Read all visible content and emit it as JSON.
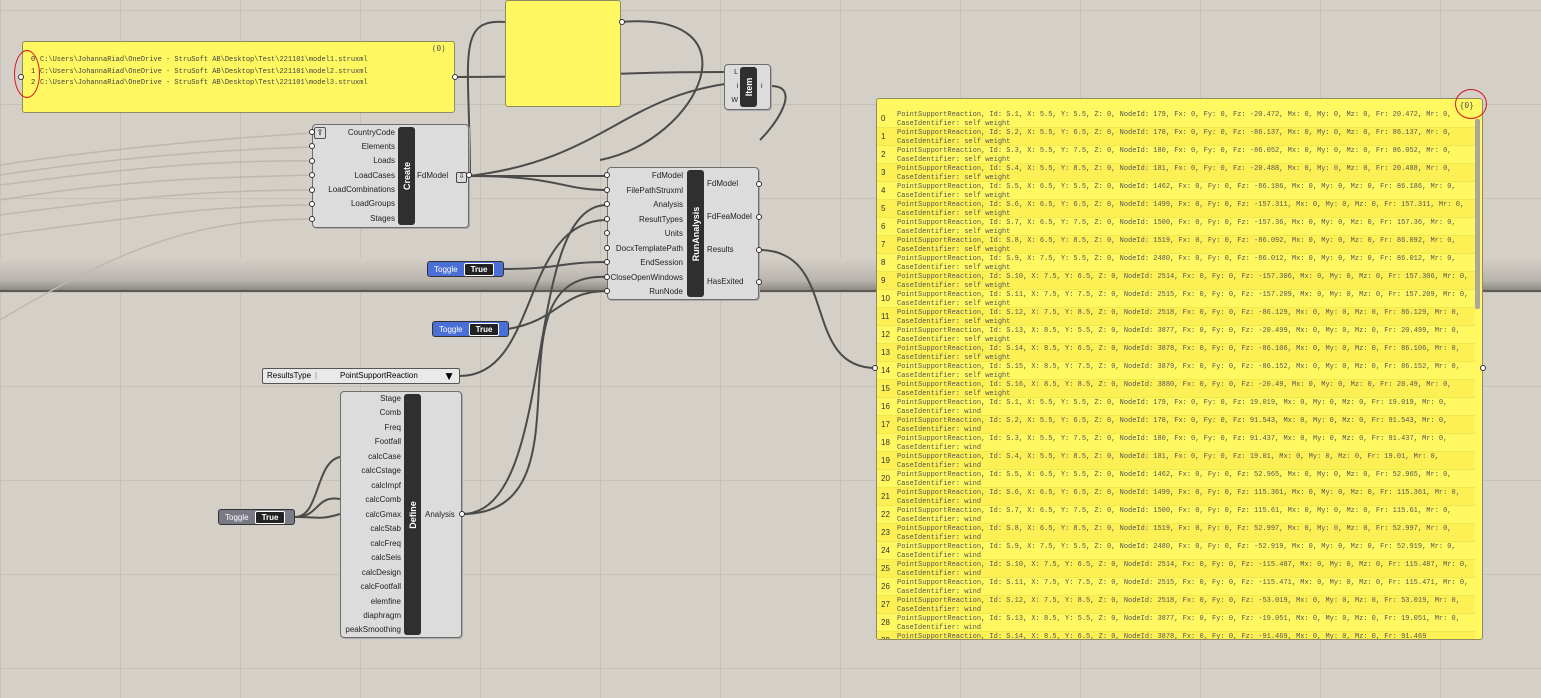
{
  "colors": {
    "canvas": "#d4d0c8",
    "panel_yellow": "#fff860",
    "toggle_blue": "#4a6fd6",
    "toggle_gray": "#7a7a86",
    "annotation_red": "#d8141c"
  },
  "path_panel": {
    "badge": "(0)",
    "items": [
      {
        "index": "0",
        "path": "C:\\Users\\JohannaRiad\\OneDrive - StruSoft AB\\Desktop\\Test\\221101\\model1.struxml"
      },
      {
        "index": "1",
        "path": "C:\\Users\\JohannaRiad\\OneDrive - StruSoft AB\\Desktop\\Test\\221101\\model2.struxml"
      },
      {
        "index": "2",
        "path": "C:\\Users\\JohannaRiad\\OneDrive - StruSoft AB\\Desktop\\Test\\221101\\model3.struxml"
      }
    ]
  },
  "item_component": {
    "inputs": [
      "L",
      "i",
      "W"
    ],
    "label": "Item",
    "output": "i"
  },
  "create_component": {
    "label": "Create",
    "inputs": [
      "CountryCode",
      "Elements",
      "Loads",
      "LoadCases",
      "LoadCombinations",
      "LoadGroups",
      "Stages"
    ],
    "output": "FdModel"
  },
  "run_component": {
    "label": "RunAnalysis",
    "inputs": [
      "FdModel",
      "FilePathStruxml",
      "Analysis",
      "ResultTypes",
      "Units",
      "DocxTemplatePath",
      "EndSession",
      "CloseOpenWindows",
      "RunNode"
    ],
    "outputs": [
      "FdModel",
      "FdFeaModel",
      "Results",
      "HasExited"
    ]
  },
  "toggles": [
    {
      "label": "Toggle",
      "value": "True"
    },
    {
      "label": "Toggle",
      "value": "True"
    },
    {
      "label": "Toggle",
      "value": "True"
    }
  ],
  "value_list": {
    "name": "ResultsType",
    "selected": "PointSupportReaction"
  },
  "define_component": {
    "label": "Define",
    "inputs": [
      "Stage",
      "Comb",
      "Freq",
      "Footfall",
      "calcCase",
      "calcCstage",
      "calcImpf",
      "calcComb",
      "calcGmax",
      "calcStab",
      "calcFreq",
      "calcSeis",
      "calcDesign",
      "calcFootfall",
      "elemfine",
      "diaphragm",
      "peakSmoothing"
    ],
    "output": "Analysis"
  },
  "results_panel": {
    "badge": "{0}",
    "rows": [
      {
        "index": "0",
        "text": "PointSupportReaction, Id: S.1, X: 5.5, Y: 5.5, Z: 0, NodeId: 179, Fx: 0, Fy: 0, Fz: -20.472, Mx: 0, My: 0, Mz: 0, Fr: 20.472, Mr: 0, CaseIdentifier: self weight"
      },
      {
        "index": "1",
        "text": "PointSupportReaction, Id: S.2, X: 5.5, Y: 6.5, Z: 0, NodeId: 178, Fx: 0, Fy: 0, Fz: -86.137, Mx: 0, My: 0, Mz: 0, Fr: 86.137, Mr: 0, CaseIdentifier: self weight"
      },
      {
        "index": "2",
        "text": "PointSupportReaction, Id: S.3, X: 5.5, Y: 7.5, Z: 0, NodeId: 180, Fx: 0, Fy: 0, Fz: -86.052, Mx: 0, My: 0, Mz: 0, Fr: 86.052, Mr: 0, CaseIdentifier: self weight"
      },
      {
        "index": "3",
        "text": "PointSupportReaction, Id: S.4, X: 5.5, Y: 8.5, Z: 0, NodeId: 181, Fx: 0, Fy: 0, Fz: -20.488, Mx: 0, My: 0, Mz: 0, Fr: 20.488, Mr: 0, CaseIdentifier: self weight"
      },
      {
        "index": "4",
        "text": "PointSupportReaction, Id: S.5, X: 6.5, Y: 5.5, Z: 0, NodeId: 1462, Fx: 0, Fy: 0, Fz: -86.186, Mx: 0, My: 0, Mz: 0, Fr: 86.186, Mr: 0, CaseIdentifier: self weight"
      },
      {
        "index": "5",
        "text": "PointSupportReaction, Id: S.6, X: 6.5, Y: 6.5, Z: 0, NodeId: 1499, Fx: 0, Fy: 0, Fz: -157.311, Mx: 0, My: 0, Mz: 0, Fr: 157.311, Mr: 0, CaseIdentifier: self weight"
      },
      {
        "index": "6",
        "text": "PointSupportReaction, Id: S.7, X: 6.5, Y: 7.5, Z: 0, NodeId: 1500, Fx: 0, Fy: 0, Fz: -157.36, Mx: 0, My: 0, Mz: 0, Fr: 157.36, Mr: 0, CaseIdentifier: self weight"
      },
      {
        "index": "7",
        "text": "PointSupportReaction, Id: S.8, X: 6.5, Y: 8.5, Z: 0, NodeId: 1519, Fx: 0, Fy: 0, Fz: -86.092, Mx: 0, My: 0, Mz: 0, Fr: 86.092, Mr: 0, CaseIdentifier: self weight"
      },
      {
        "index": "8",
        "text": "PointSupportReaction, Id: S.9, X: 7.5, Y: 5.5, Z: 0, NodeId: 2480, Fx: 0, Fy: 0, Fz: -86.012, Mx: 0, My: 0, Mz: 0, Fr: 86.012, Mr: 0, CaseIdentifier: self weight"
      },
      {
        "index": "9",
        "text": "PointSupportReaction, Id: S.10, X: 7.5, Y: 6.5, Z: 0, NodeId: 2514, Fx: 0, Fy: 0, Fz: -157.306, Mx: 0, My: 0, Mz: 0, Fr: 157.306, Mr: 0, CaseIdentifier: self weight"
      },
      {
        "index": "10",
        "text": "PointSupportReaction, Id: S.11, X: 7.5, Y: 7.5, Z: 0, NodeId: 2515, Fx: 0, Fy: 0, Fz: -157.209, Mx: 0, My: 0, Mz: 0, Fr: 157.209, Mr: 0, CaseIdentifier: self weight"
      },
      {
        "index": "11",
        "text": "PointSupportReaction, Id: S.12, X: 7.5, Y: 8.5, Z: 0, NodeId: 2518, Fx: 0, Fy: 0, Fz: -86.129, Mx: 0, My: 0, Mz: 0, Fr: 86.129, Mr: 0, CaseIdentifier: self weight"
      },
      {
        "index": "12",
        "text": "PointSupportReaction, Id: S.13, X: 8.5, Y: 5.5, Z: 0, NodeId: 3877, Fx: 0, Fy: 0, Fz: -20.499, Mx: 0, My: 0, Mz: 0, Fr: 20.499, Mr: 0, CaseIdentifier: self weight"
      },
      {
        "index": "13",
        "text": "PointSupportReaction, Id: S.14, X: 8.5, Y: 6.5, Z: 0, NodeId: 3878, Fx: 0, Fy: 0, Fz: -86.106, Mx: 0, My: 0, Mz: 0, Fr: 86.106, Mr: 0, CaseIdentifier: self weight"
      },
      {
        "index": "14",
        "text": "PointSupportReaction, Id: S.15, X: 8.5, Y: 7.5, Z: 0, NodeId: 3879, Fx: 0, Fy: 0, Fz: -86.152, Mx: 0, My: 0, Mz: 0, Fr: 86.152, Mr: 0, CaseIdentifier: self weight"
      },
      {
        "index": "15",
        "text": "PointSupportReaction, Id: S.16, X: 8.5, Y: 8.5, Z: 0, NodeId: 3880, Fx: 0, Fy: 0, Fz: -20.49, Mx: 0, My: 0, Mz: 0, Fr: 20.49, Mr: 0, CaseIdentifier: self weight"
      },
      {
        "index": "16",
        "text": "PointSupportReaction, Id: S.1, X: 5.5, Y: 5.5, Z: 0, NodeId: 179, Fx: 0, Fy: 0, Fz: 19.019, Mx: 0, My: 0, Mz: 0, Fr: 19.019, Mr: 0, CaseIdentifier: wind"
      },
      {
        "index": "17",
        "text": "PointSupportReaction, Id: S.2, X: 5.5, Y: 6.5, Z: 0, NodeId: 178, Fx: 0, Fy: 0, Fz: 91.543, Mx: 0, My: 0, Mz: 0, Fr: 91.543, Mr: 0, CaseIdentifier: wind"
      },
      {
        "index": "18",
        "text": "PointSupportReaction, Id: S.3, X: 5.5, Y: 7.5, Z: 0, NodeId: 180, Fx: 0, Fy: 0, Fz: 91.437, Mx: 0, My: 0, Mz: 0, Fr: 91.437, Mr: 0, CaseIdentifier: wind"
      },
      {
        "index": "19",
        "text": "PointSupportReaction, Id: S.4, X: 5.5, Y: 8.5, Z: 0, NodeId: 181, Fx: 0, Fy: 0, Fz: 19.01, Mx: 0, My: 0, Mz: 0, Fr: 19.01, Mr: 0, CaseIdentifier: wind"
      },
      {
        "index": "20",
        "text": "PointSupportReaction, Id: S.5, X: 6.5, Y: 5.5, Z: 0, NodeId: 1462, Fx: 0, Fy: 0, Fz: 52.965, Mx: 0, My: 0, Mz: 0, Fr: 52.965, Mr: 0, CaseIdentifier: wind"
      },
      {
        "index": "21",
        "text": "PointSupportReaction, Id: S.6, X: 6.5, Y: 6.5, Z: 0, NodeId: 1499, Fx: 0, Fy: 0, Fz: 115.361, Mx: 0, My: 0, Mz: 0, Fr: 115.361, Mr: 0, CaseIdentifier: wind"
      },
      {
        "index": "22",
        "text": "PointSupportReaction, Id: S.7, X: 6.5, Y: 7.5, Z: 0, NodeId: 1500, Fx: 0, Fy: 0, Fz: 115.61, Mx: 0, My: 0, Mz: 0, Fr: 115.61, Mr: 0, CaseIdentifier: wind"
      },
      {
        "index": "23",
        "text": "PointSupportReaction, Id: S.8, X: 6.5, Y: 8.5, Z: 0, NodeId: 1519, Fx: 0, Fy: 0, Fz: 52.997, Mx: 0, My: 0, Mz: 0, Fr: 52.997, Mr: 0, CaseIdentifier: wind"
      },
      {
        "index": "24",
        "text": "PointSupportReaction, Id: S.9, X: 7.5, Y: 5.5, Z: 0, NodeId: 2480, Fx: 0, Fy: 0, Fz: -52.919, Mx: 0, My: 0, Mz: 0, Fr: 52.919, Mr: 0, CaseIdentifier: wind"
      },
      {
        "index": "25",
        "text": "PointSupportReaction, Id: S.10, X: 7.5, Y: 6.5, Z: 0, NodeId: 2514, Fx: 0, Fy: 0, Fz: -115.487, Mx: 0, My: 0, Mz: 0, Fr: 115.487, Mr: 0, CaseIdentifier: wind"
      },
      {
        "index": "26",
        "text": "PointSupportReaction, Id: S.11, X: 7.5, Y: 7.5, Z: 0, NodeId: 2515, Fx: 0, Fy: 0, Fz: -115.471, Mx: 0, My: 0, Mz: 0, Fr: 115.471, Mr: 0, CaseIdentifier: wind"
      },
      {
        "index": "27",
        "text": "PointSupportReaction, Id: S.12, X: 7.5, Y: 8.5, Z: 0, NodeId: 2518, Fx: 0, Fy: 0, Fz: -53.019, Mx: 0, My: 0, Mz: 0, Fr: 53.019, Mr: 0, CaseIdentifier: wind"
      },
      {
        "index": "28",
        "text": "PointSupportReaction, Id: S.13, X: 8.5, Y: 5.5, Z: 0, NodeId: 3877, Fx: 0, Fy: 0, Fz: -19.051, Mx: 0, My: 0, Mz: 0, Fr: 19.051, Mr: 0, CaseIdentifier: wind"
      },
      {
        "index": "29",
        "text": "PointSupportReaction, Id: S.14, X: 8.5, Y: 6.5, Z: 0, NodeId: 3878, Fx: 0, Fy: 0, Fz: -91.469, Mx: 0, My: 0, Mz: 0, Fr: 91.469"
      }
    ]
  }
}
